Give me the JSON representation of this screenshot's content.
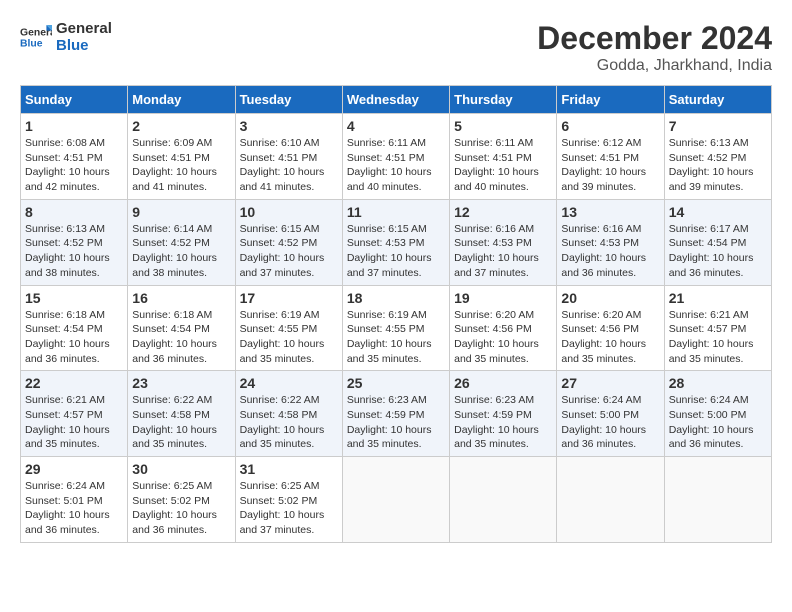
{
  "header": {
    "logo_general": "General",
    "logo_blue": "Blue",
    "title": "December 2024",
    "subtitle": "Godda, Jharkhand, India"
  },
  "calendar": {
    "headers": [
      "Sunday",
      "Monday",
      "Tuesday",
      "Wednesday",
      "Thursday",
      "Friday",
      "Saturday"
    ],
    "weeks": [
      [
        {
          "day": "1",
          "sunrise": "Sunrise: 6:08 AM",
          "sunset": "Sunset: 4:51 PM",
          "daylight": "Daylight: 10 hours and 42 minutes."
        },
        {
          "day": "2",
          "sunrise": "Sunrise: 6:09 AM",
          "sunset": "Sunset: 4:51 PM",
          "daylight": "Daylight: 10 hours and 41 minutes."
        },
        {
          "day": "3",
          "sunrise": "Sunrise: 6:10 AM",
          "sunset": "Sunset: 4:51 PM",
          "daylight": "Daylight: 10 hours and 41 minutes."
        },
        {
          "day": "4",
          "sunrise": "Sunrise: 6:11 AM",
          "sunset": "Sunset: 4:51 PM",
          "daylight": "Daylight: 10 hours and 40 minutes."
        },
        {
          "day": "5",
          "sunrise": "Sunrise: 6:11 AM",
          "sunset": "Sunset: 4:51 PM",
          "daylight": "Daylight: 10 hours and 40 minutes."
        },
        {
          "day": "6",
          "sunrise": "Sunrise: 6:12 AM",
          "sunset": "Sunset: 4:51 PM",
          "daylight": "Daylight: 10 hours and 39 minutes."
        },
        {
          "day": "7",
          "sunrise": "Sunrise: 6:13 AM",
          "sunset": "Sunset: 4:52 PM",
          "daylight": "Daylight: 10 hours and 39 minutes."
        }
      ],
      [
        {
          "day": "8",
          "sunrise": "Sunrise: 6:13 AM",
          "sunset": "Sunset: 4:52 PM",
          "daylight": "Daylight: 10 hours and 38 minutes."
        },
        {
          "day": "9",
          "sunrise": "Sunrise: 6:14 AM",
          "sunset": "Sunset: 4:52 PM",
          "daylight": "Daylight: 10 hours and 38 minutes."
        },
        {
          "day": "10",
          "sunrise": "Sunrise: 6:15 AM",
          "sunset": "Sunset: 4:52 PM",
          "daylight": "Daylight: 10 hours and 37 minutes."
        },
        {
          "day": "11",
          "sunrise": "Sunrise: 6:15 AM",
          "sunset": "Sunset: 4:53 PM",
          "daylight": "Daylight: 10 hours and 37 minutes."
        },
        {
          "day": "12",
          "sunrise": "Sunrise: 6:16 AM",
          "sunset": "Sunset: 4:53 PM",
          "daylight": "Daylight: 10 hours and 37 minutes."
        },
        {
          "day": "13",
          "sunrise": "Sunrise: 6:16 AM",
          "sunset": "Sunset: 4:53 PM",
          "daylight": "Daylight: 10 hours and 36 minutes."
        },
        {
          "day": "14",
          "sunrise": "Sunrise: 6:17 AM",
          "sunset": "Sunset: 4:54 PM",
          "daylight": "Daylight: 10 hours and 36 minutes."
        }
      ],
      [
        {
          "day": "15",
          "sunrise": "Sunrise: 6:18 AM",
          "sunset": "Sunset: 4:54 PM",
          "daylight": "Daylight: 10 hours and 36 minutes."
        },
        {
          "day": "16",
          "sunrise": "Sunrise: 6:18 AM",
          "sunset": "Sunset: 4:54 PM",
          "daylight": "Daylight: 10 hours and 36 minutes."
        },
        {
          "day": "17",
          "sunrise": "Sunrise: 6:19 AM",
          "sunset": "Sunset: 4:55 PM",
          "daylight": "Daylight: 10 hours and 35 minutes."
        },
        {
          "day": "18",
          "sunrise": "Sunrise: 6:19 AM",
          "sunset": "Sunset: 4:55 PM",
          "daylight": "Daylight: 10 hours and 35 minutes."
        },
        {
          "day": "19",
          "sunrise": "Sunrise: 6:20 AM",
          "sunset": "Sunset: 4:56 PM",
          "daylight": "Daylight: 10 hours and 35 minutes."
        },
        {
          "day": "20",
          "sunrise": "Sunrise: 6:20 AM",
          "sunset": "Sunset: 4:56 PM",
          "daylight": "Daylight: 10 hours and 35 minutes."
        },
        {
          "day": "21",
          "sunrise": "Sunrise: 6:21 AM",
          "sunset": "Sunset: 4:57 PM",
          "daylight": "Daylight: 10 hours and 35 minutes."
        }
      ],
      [
        {
          "day": "22",
          "sunrise": "Sunrise: 6:21 AM",
          "sunset": "Sunset: 4:57 PM",
          "daylight": "Daylight: 10 hours and 35 minutes."
        },
        {
          "day": "23",
          "sunrise": "Sunrise: 6:22 AM",
          "sunset": "Sunset: 4:58 PM",
          "daylight": "Daylight: 10 hours and 35 minutes."
        },
        {
          "day": "24",
          "sunrise": "Sunrise: 6:22 AM",
          "sunset": "Sunset: 4:58 PM",
          "daylight": "Daylight: 10 hours and 35 minutes."
        },
        {
          "day": "25",
          "sunrise": "Sunrise: 6:23 AM",
          "sunset": "Sunset: 4:59 PM",
          "daylight": "Daylight: 10 hours and 35 minutes."
        },
        {
          "day": "26",
          "sunrise": "Sunrise: 6:23 AM",
          "sunset": "Sunset: 4:59 PM",
          "daylight": "Daylight: 10 hours and 35 minutes."
        },
        {
          "day": "27",
          "sunrise": "Sunrise: 6:24 AM",
          "sunset": "Sunset: 5:00 PM",
          "daylight": "Daylight: 10 hours and 36 minutes."
        },
        {
          "day": "28",
          "sunrise": "Sunrise: 6:24 AM",
          "sunset": "Sunset: 5:00 PM",
          "daylight": "Daylight: 10 hours and 36 minutes."
        }
      ],
      [
        {
          "day": "29",
          "sunrise": "Sunrise: 6:24 AM",
          "sunset": "Sunset: 5:01 PM",
          "daylight": "Daylight: 10 hours and 36 minutes."
        },
        {
          "day": "30",
          "sunrise": "Sunrise: 6:25 AM",
          "sunset": "Sunset: 5:02 PM",
          "daylight": "Daylight: 10 hours and 36 minutes."
        },
        {
          "day": "31",
          "sunrise": "Sunrise: 6:25 AM",
          "sunset": "Sunset: 5:02 PM",
          "daylight": "Daylight: 10 hours and 37 minutes."
        },
        {
          "day": "",
          "sunrise": "",
          "sunset": "",
          "daylight": ""
        },
        {
          "day": "",
          "sunrise": "",
          "sunset": "",
          "daylight": ""
        },
        {
          "day": "",
          "sunrise": "",
          "sunset": "",
          "daylight": ""
        },
        {
          "day": "",
          "sunrise": "",
          "sunset": "",
          "daylight": ""
        }
      ]
    ]
  }
}
